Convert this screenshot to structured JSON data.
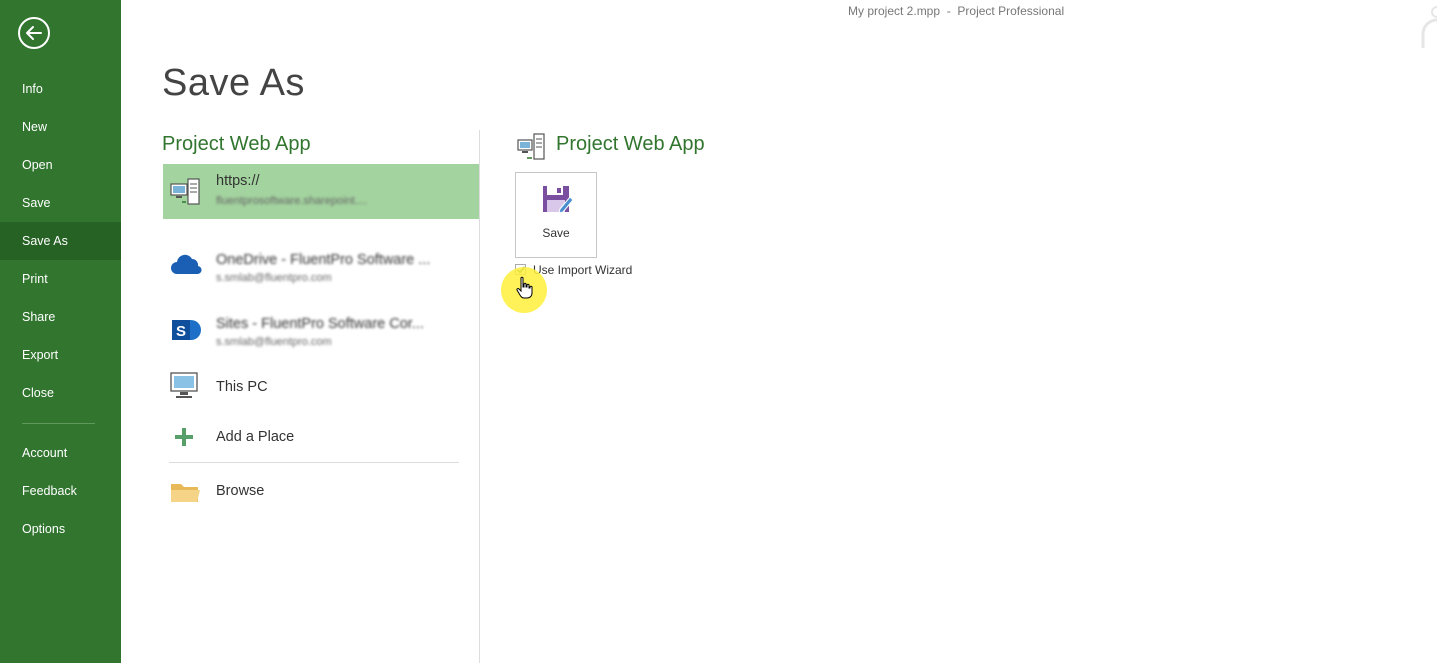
{
  "window": {
    "document_name": "My project 2.mpp",
    "separator": "  -  ",
    "app_name": "Project Professional"
  },
  "sidebar": {
    "items": [
      {
        "label": "Info"
      },
      {
        "label": "New"
      },
      {
        "label": "Open"
      },
      {
        "label": "Save"
      },
      {
        "label": "Save As",
        "active": true
      },
      {
        "label": "Print"
      },
      {
        "label": "Share"
      },
      {
        "label": "Export"
      },
      {
        "label": "Close"
      },
      {
        "label": "Account"
      },
      {
        "label": "Feedback"
      },
      {
        "label": "Options"
      }
    ]
  },
  "page": {
    "title": "Save As"
  },
  "places": {
    "heading": "Project Web App",
    "items": [
      {
        "primary": "https://",
        "secondary": "fluentprosoftware.sharepoint....",
        "icon": "project-web-app-icon",
        "selected": true
      },
      {
        "primary": "OneDrive - FluentPro Software ...",
        "secondary": "s.smlab@fluentpro.com",
        "icon": "onedrive-cloud-icon"
      },
      {
        "primary": "Sites - FluentPro Software Cor...",
        "secondary": "s.smlab@fluentpro.com",
        "icon": "sharepoint-icon"
      },
      {
        "primary": "This PC",
        "icon": "computer-icon"
      },
      {
        "primary": "Add a Place",
        "icon": "plus-icon"
      },
      {
        "primary": "Browse",
        "icon": "folder-icon"
      }
    ]
  },
  "detail": {
    "heading": "Project Web App",
    "save_button_label": "Save",
    "wizard_label": "Use Import Wizard",
    "wizard_checked": true
  },
  "colors": {
    "sidebar_bg": "#31752f",
    "sidebar_active": "#266224",
    "accent_green": "#31752f",
    "selected_place": "#a3d39f",
    "save_icon_purple": "#7b4fa0"
  }
}
